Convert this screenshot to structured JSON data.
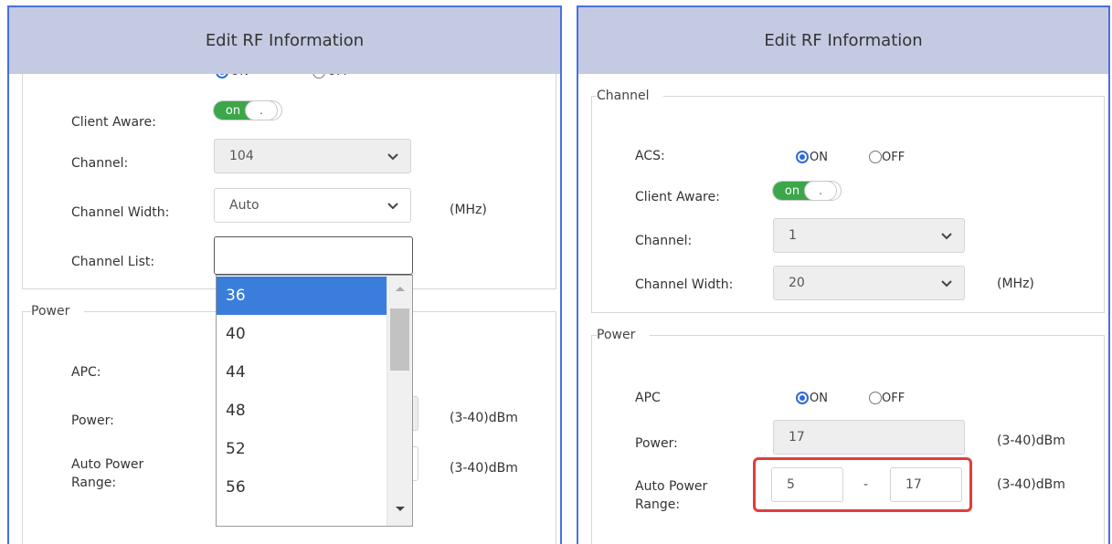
{
  "left_panel": {
    "header_title": "Edit RF Information",
    "partial_radio": {
      "on_label": "ON",
      "off_label": "OFF"
    },
    "client_aware": {
      "label": "Client Aware:",
      "on": "on",
      "knob": "."
    },
    "channel": {
      "label": "Channel:",
      "value": "104"
    },
    "channel_width": {
      "label": "Channel Width:",
      "value": "Auto",
      "unit": "(MHz)"
    },
    "channel_list": {
      "label": "Channel List:",
      "value": ""
    },
    "channel_list_options": [
      "36",
      "40",
      "44",
      "48",
      "52",
      "56"
    ],
    "selected_option": "36",
    "power_legend": "Power",
    "apc_label": "APC:",
    "power": {
      "label": "Power:",
      "unit": "(3-40)dBm"
    },
    "auto_power_range": {
      "label_line1": "Auto Power",
      "label_line2": "Range:",
      "unit": "(3-40)dBm"
    }
  },
  "right_panel": {
    "header_title": "Edit RF Information",
    "channel_legend": "Channel",
    "acs": {
      "label": "ACS:",
      "on_label": "ON",
      "off_label": "OFF",
      "selected": "ON"
    },
    "client_aware": {
      "label": "Client Aware:",
      "on": "on",
      "knob": "."
    },
    "channel": {
      "label": "Channel:",
      "value": "1"
    },
    "channel_width": {
      "label": "Channel Width:",
      "value": "20",
      "unit": "(MHz)"
    },
    "power_legend": "Power",
    "apc": {
      "label": "APC",
      "on_label": "ON",
      "off_label": "OFF",
      "selected": "ON"
    },
    "power": {
      "label": "Power:",
      "value": "17",
      "unit": "(3-40)dBm"
    },
    "auto_power_range": {
      "label_line1": "Auto Power",
      "label_line2": "Range:",
      "min": "5",
      "separator": "-",
      "max": "17",
      "unit": "(3-40)dBm"
    }
  },
  "colors": {
    "header_bg": "#c4cae2",
    "panel_border": "#4a6fe0",
    "toggle_green": "#3ca64a",
    "radio_blue": "#2d6bd8",
    "dropdown_selected": "#3b7ddb",
    "highlight_red": "#e23c3c"
  }
}
